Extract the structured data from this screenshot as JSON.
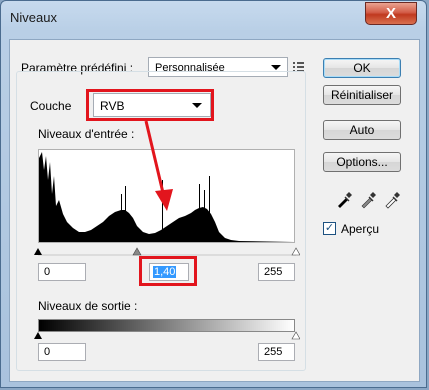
{
  "window": {
    "title": "Niveaux",
    "close_glyph": "X"
  },
  "preset": {
    "label": "Paramètre prédéfini :",
    "value": "Personnalisée"
  },
  "channel": {
    "label": "Couche",
    "value": "RVB"
  },
  "input_levels": {
    "label": "Niveaux d'entrée :",
    "black": "0",
    "gamma": "1,40",
    "white": "255"
  },
  "output_levels": {
    "label": "Niveaux de sortie :",
    "black": "0",
    "white": "255"
  },
  "buttons": {
    "ok": "OK",
    "reset": "Réinitialiser",
    "auto": "Auto",
    "options": "Options..."
  },
  "preview": {
    "label": "Aperçu",
    "checked": "✓"
  },
  "accent": {
    "highlight": "#e2151d",
    "selection": "#3399ff"
  }
}
